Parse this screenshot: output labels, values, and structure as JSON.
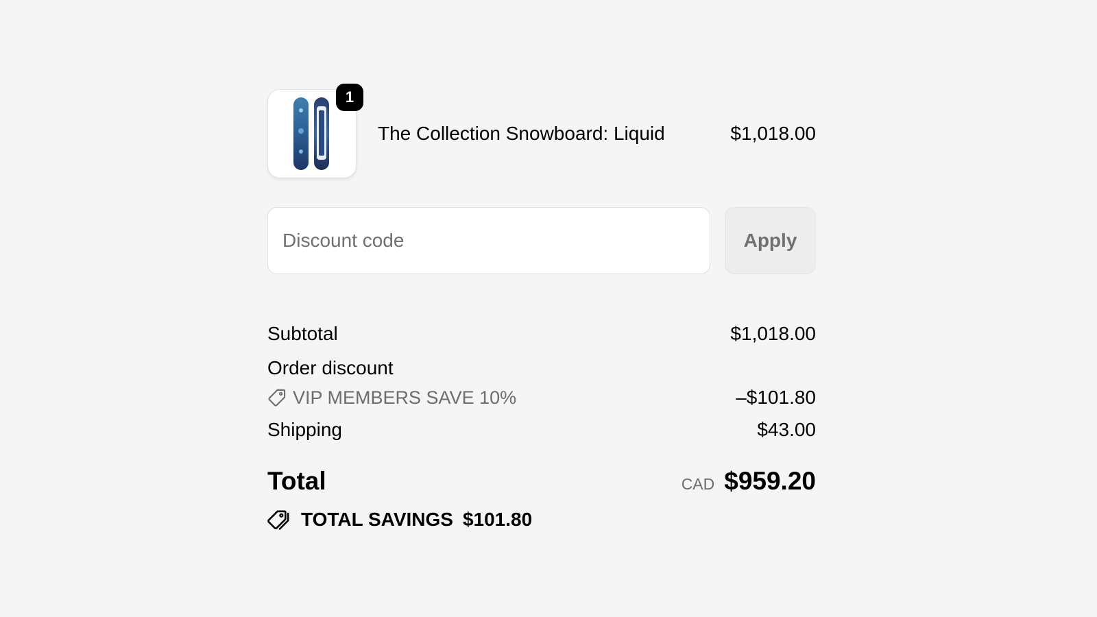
{
  "cart": {
    "items": [
      {
        "name": "The Collection Snowboard: Liquid",
        "price": "$1,018.00",
        "quantity": "1",
        "thumbnail_icon": "snowboard-image"
      }
    ]
  },
  "discount": {
    "placeholder": "Discount code",
    "value": "",
    "apply_label": "Apply"
  },
  "totals": {
    "subtotal_label": "Subtotal",
    "subtotal_value": "$1,018.00",
    "order_discount_label": "Order discount",
    "discount_code": "VIP MEMBERS SAVE 10%",
    "discount_value": "–$101.80",
    "shipping_label": "Shipping",
    "shipping_value": "$43.00",
    "total_label": "Total",
    "currency": "CAD",
    "total_value": "$959.20",
    "savings_label": "TOTAL SAVINGS",
    "savings_value": "$101.80"
  },
  "colors": {
    "background": "#f5f5f5",
    "muted_text": "#6d6d6d",
    "badge": "#000000"
  }
}
